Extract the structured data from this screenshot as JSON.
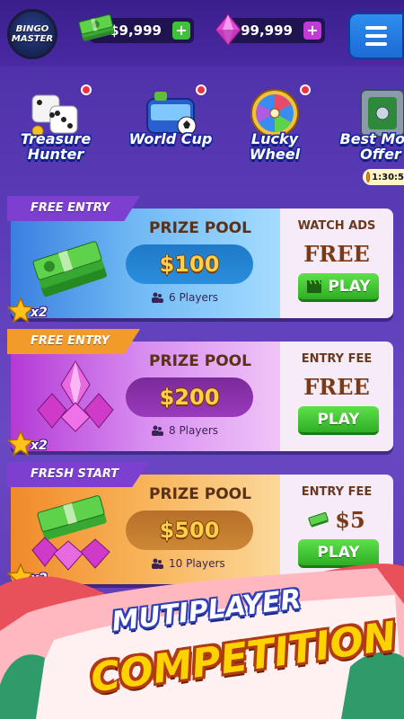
{
  "header": {
    "logo_text": "BINGO MASTER",
    "cash_amount": "$9,999",
    "gem_amount": "99,999",
    "plus_label": "+"
  },
  "features": [
    {
      "label": "Treasure Hunter"
    },
    {
      "label": "World Cup"
    },
    {
      "label": "Lucky Wheel"
    },
    {
      "label": "Best Mo... Offer"
    }
  ],
  "offer_timer": "1:30:5",
  "cards": [
    {
      "banner": "FREE ENTRY",
      "pool_title": "PRIZE POOL",
      "prize": "$100",
      "players": "6 Players",
      "right_title": "WATCH ADS",
      "right_value": "FREE",
      "play_label": "PLAY",
      "multiplier": "x2"
    },
    {
      "banner": "FREE ENTRY",
      "pool_title": "PRIZE POOL",
      "prize": "$200",
      "players": "8 Players",
      "right_title": "ENTRY FEE",
      "right_value": "FREE",
      "play_label": "PLAY",
      "multiplier": "x2"
    },
    {
      "banner": "FRESH START",
      "pool_title": "PRIZE POOL",
      "prize": "$500",
      "players": "10 Players",
      "right_title": "ENTRY FEE",
      "right_value": "$5",
      "play_label": "PLAY",
      "multiplier": "x2"
    }
  ],
  "promo": {
    "line1": "MUTIPLAYER",
    "line2": "COMPETITION"
  },
  "colors": {
    "background": "#5a3bb6",
    "play_green": "#3fc23a",
    "prize_gold": "#ffd04a"
  }
}
